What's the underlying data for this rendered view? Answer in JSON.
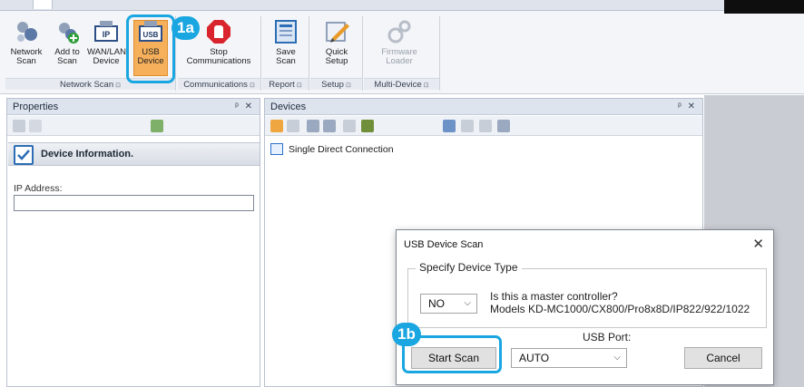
{
  "ribbon": {
    "groups": {
      "network_scan": {
        "label": "Network Scan"
      },
      "communications": {
        "label": "Communications"
      },
      "report": {
        "label": "Report"
      },
      "setup": {
        "label": "Setup"
      },
      "multi_device": {
        "label": "Multi-Device"
      }
    },
    "buttons": {
      "network_scan": {
        "line1": "Network",
        "line2": "Scan"
      },
      "add_to_scan": {
        "line1": "Add to",
        "line2": "Scan"
      },
      "wan_lan": {
        "line1": "WAN/LAN",
        "line2": "Device",
        "icon_text": "IP"
      },
      "usb_device": {
        "line1": "USB",
        "line2": "Device",
        "icon_text": "USB"
      },
      "stop_comm": {
        "line1": "Stop",
        "line2": "Communications"
      },
      "save_scan": {
        "line1": "Save",
        "line2": "Scan"
      },
      "quick_setup": {
        "line1": "Quick",
        "line2": "Setup"
      },
      "firmware_loader": {
        "line1": "Firmware",
        "line2": "Loader"
      }
    },
    "launcher_glyph": "⊡"
  },
  "callouts": {
    "step_1a": "1a",
    "step_1b": "1b"
  },
  "properties_panel": {
    "title": "Properties",
    "pin_close": "ᵖ ✕",
    "section_title": "Device Information.",
    "ip_label": "IP Address:",
    "ip_value": ""
  },
  "devices_panel": {
    "title": "Devices",
    "pin_close": "ᵖ ✕",
    "tree_items": [
      "Single Direct Connection"
    ]
  },
  "dialog": {
    "title": "USB Device Scan",
    "close_glyph": "✕",
    "device_type_legend": "Specify Device Type",
    "master_select_value": "NO",
    "question_line1": "Is this a master controller?",
    "question_line2": "Models KD-MC1000/CX800/Pro8x8D/IP822/922/1022",
    "port_label": "USB Port:",
    "port_select_value": "AUTO",
    "start_button": "Start Scan",
    "cancel_button": "Cancel",
    "dropdown_glyph": "⌵"
  },
  "colors": {
    "callout_blue": "#1aa6e0",
    "usb_active_orange": "#f6b05b",
    "stop_red": "#d9232d"
  }
}
